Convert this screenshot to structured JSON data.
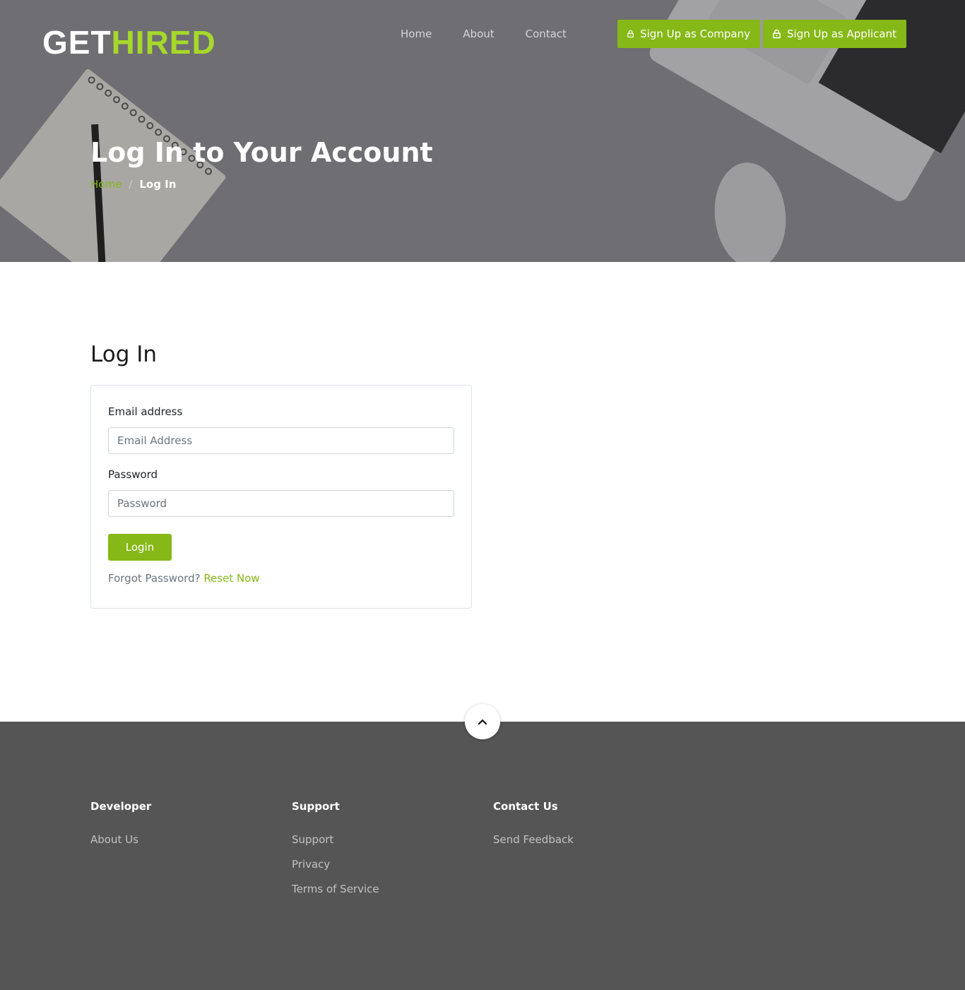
{
  "brand": {
    "part1": "GET",
    "part2": "HIRED"
  },
  "nav": {
    "home": "Home",
    "about": "About",
    "contact": "Contact"
  },
  "signup": {
    "company": "Sign Up as Company",
    "applicant": "Sign Up as Applicant"
  },
  "hero": {
    "title": "Log In to Your Account"
  },
  "breadcrumb": {
    "home": "Home",
    "separator": "/",
    "current": "Log In"
  },
  "login": {
    "heading": "Log In",
    "email_label": "Email address",
    "email_placeholder": "Email Address",
    "email_value": "",
    "password_label": "Password",
    "password_placeholder": "Password",
    "password_value": "",
    "submit": "Login",
    "forgot_text": "Forgot Password?",
    "reset_link": "Reset Now"
  },
  "footer": {
    "developer": {
      "title": "Developer",
      "links": [
        "About Us"
      ]
    },
    "support": {
      "title": "Support",
      "links": [
        "Support",
        "Privacy",
        "Terms of Service"
      ]
    },
    "contact": {
      "title": "Contact Us",
      "links": [
        "Send Feedback"
      ]
    }
  },
  "icons": {
    "signup_icon": "lock-icon",
    "scroll_top": "chevron-up-icon"
  },
  "colors": {
    "accent": "#86b817",
    "logo_accent": "#a6d82b",
    "hero_overlay": "#6f6e72",
    "footer_bg": "#555555"
  }
}
